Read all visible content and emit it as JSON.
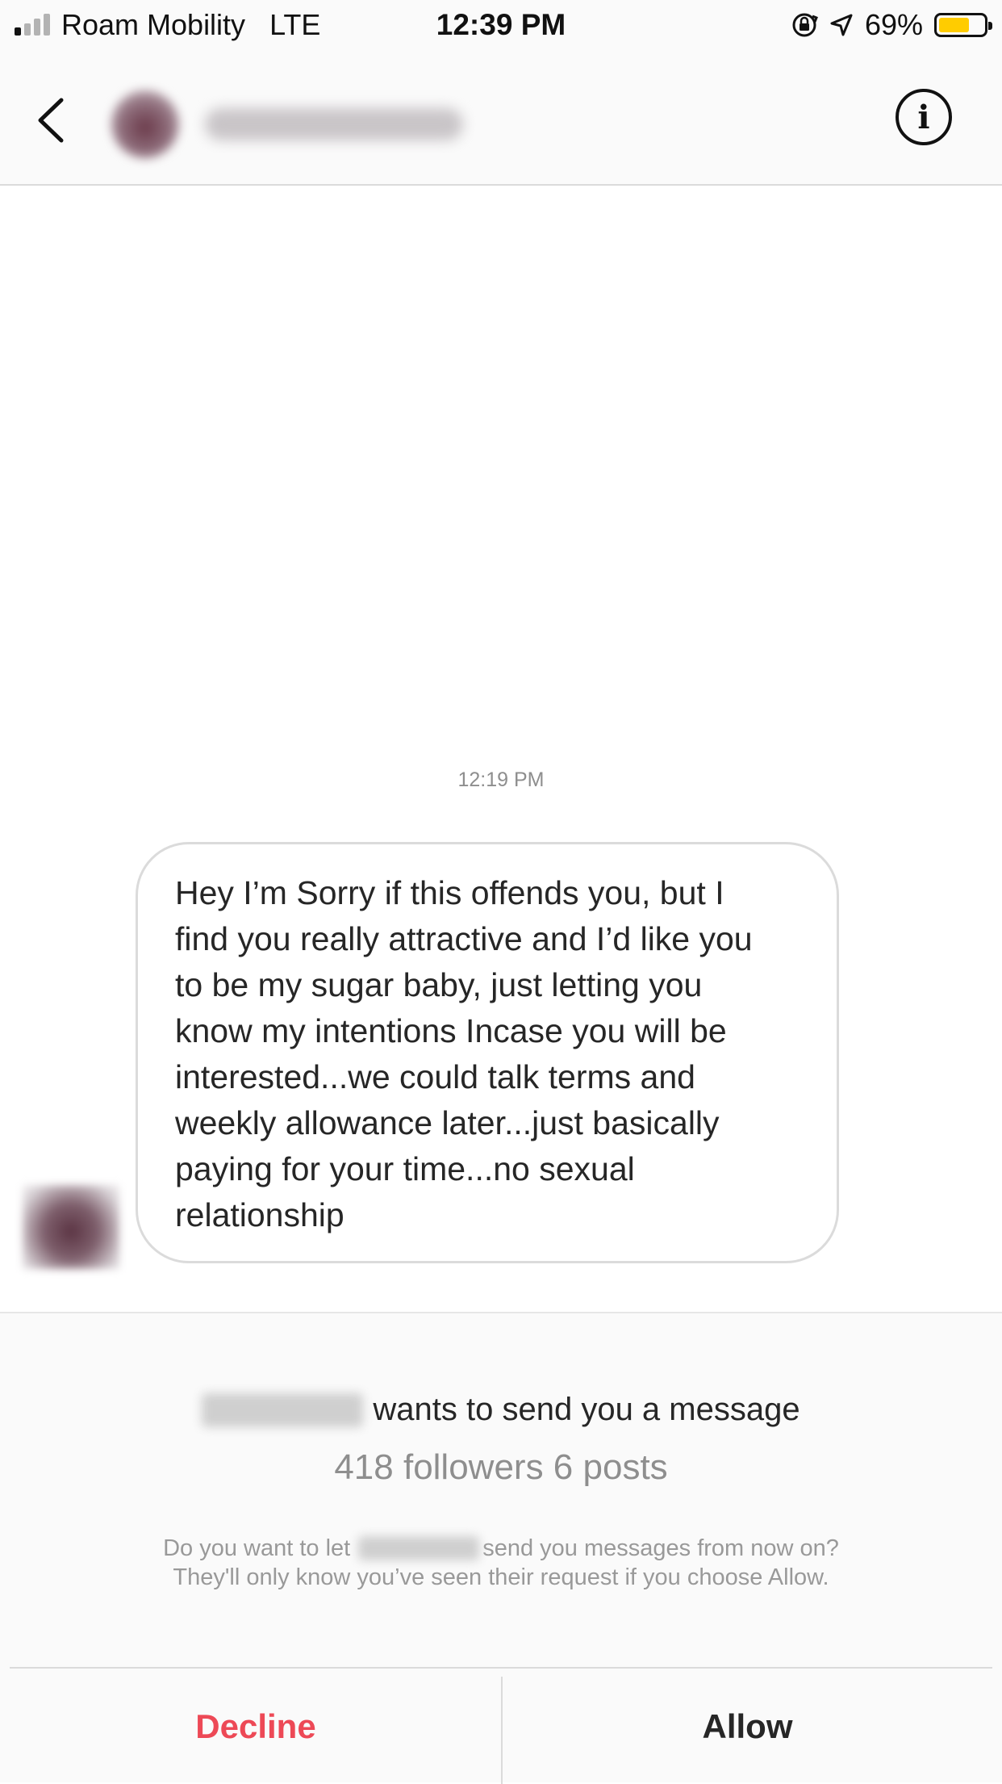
{
  "status_bar": {
    "carrier": "Roam Mobility",
    "network": "LTE",
    "time": "12:39 PM",
    "battery_percent": "69%",
    "battery_level": 0.69,
    "signal_bars_active": 1,
    "signal_bars_total": 4,
    "icons": [
      "orientation-lock-icon",
      "location-arrow-icon",
      "battery-icon"
    ]
  },
  "header": {
    "back_icon": "chevron-left-icon",
    "info_icon": "info-circle-icon",
    "info_glyph": "i"
  },
  "conversation": {
    "timestamp": "12:19 PM",
    "message": {
      "lines": [
        "Hey I’m Sorry if this offends you, but I",
        "find you really attractive and I’d like you",
        "to be my sugar baby, just letting you",
        "know my intentions Incase you will be",
        "interested...we could talk terms and",
        "weekly allowance later...just basically",
        "paying for your time...no sexual",
        "relationship"
      ]
    }
  },
  "request": {
    "wants_text": "wants to send you a message",
    "stats": "418 followers 6 posts",
    "prompt_prefix": "Do you want to let",
    "prompt_suffix": "send you messages from now on?",
    "prompt_line2": "They'll only know you’ve seen their request if you choose Allow.",
    "decline_label": "Decline",
    "allow_label": "Allow"
  },
  "colors": {
    "decline": "#ed4956",
    "battery": "#ffcc00",
    "secondary_text": "#8e8e8e",
    "border": "#dbdbdb",
    "panel_bg": "#fafafa"
  }
}
